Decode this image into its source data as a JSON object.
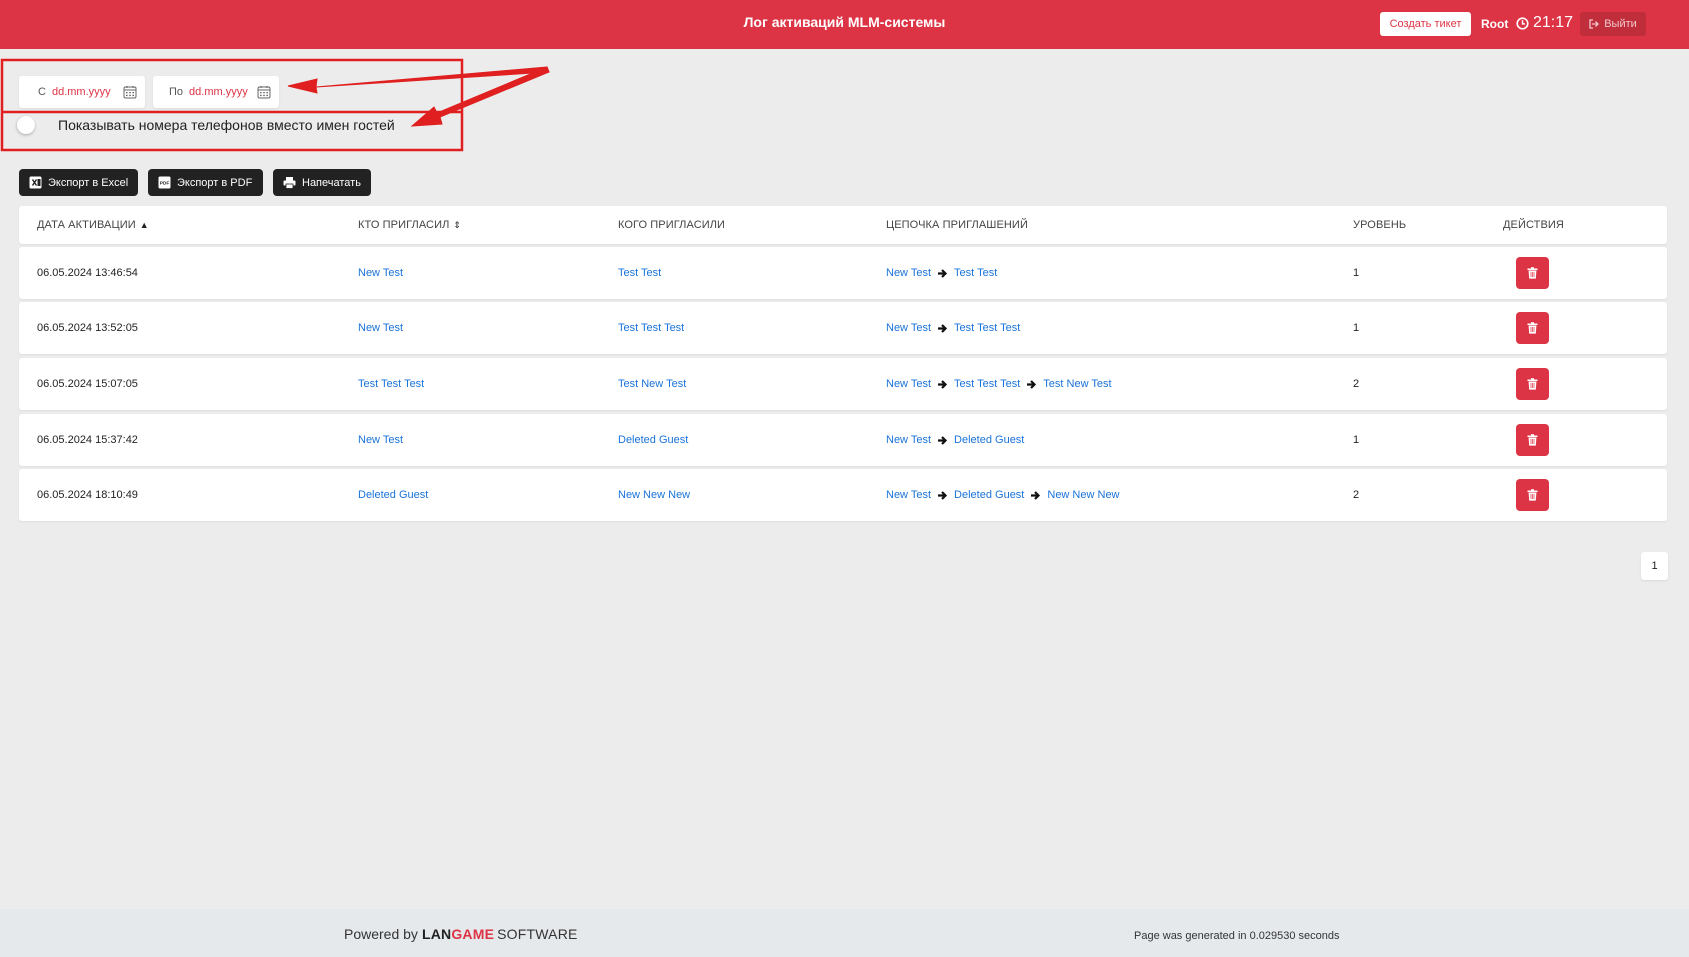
{
  "header": {
    "title": "Лог активаций MLM-системы",
    "create_ticket": "Создать тикет",
    "user": "Root",
    "time": "21:17",
    "logout": "Выйти",
    "brand_color": "#dd3445"
  },
  "filters": {
    "from_prefix": "С",
    "from_placeholder": "dd.mm.yyyy",
    "to_prefix": "По",
    "to_placeholder": "dd.mm.yyyy",
    "show_phones_label": "Показывать номера телефонов вместо имен гостей",
    "show_phones_checked": false
  },
  "export": {
    "excel": "Экспорт в Excel",
    "pdf": "Экспорт в PDF",
    "print": "Напечатать"
  },
  "table": {
    "columns": [
      "ДАТА АКТИВАЦИИ",
      "КТО ПРИГЛАСИЛ",
      "КОГО ПРИГЛАСИЛИ",
      "ЦЕПОЧКА ПРИГЛАШЕНИЙ",
      "УРОВЕНЬ",
      "ДЕЙСТВИЯ"
    ],
    "rows": [
      {
        "date": "06.05.2024 13:46:54",
        "inviter": "New Test",
        "invitee": "Test Test",
        "chain": [
          "New Test",
          "Test Test"
        ],
        "level": "1"
      },
      {
        "date": "06.05.2024 13:52:05",
        "inviter": "New Test",
        "invitee": "Test Test Test",
        "chain": [
          "New Test",
          "Test Test Test"
        ],
        "level": "1"
      },
      {
        "date": "06.05.2024 15:07:05",
        "inviter": "Test Test Test",
        "invitee": "Test New Test",
        "chain": [
          "New Test",
          "Test Test Test",
          "Test New Test"
        ],
        "level": "2"
      },
      {
        "date": "06.05.2024 15:37:42",
        "inviter": "New Test",
        "invitee": "Deleted Guest",
        "chain": [
          "New Test",
          "Deleted Guest"
        ],
        "level": "1"
      },
      {
        "date": "06.05.2024 18:10:49",
        "inviter": "Deleted Guest",
        "invitee": "New New New",
        "chain": [
          "New Test",
          "Deleted Guest",
          "New New New"
        ],
        "level": "2"
      }
    ]
  },
  "pagination": {
    "current": "1"
  },
  "footer": {
    "powered_by": "Powered by",
    "brand_part1": "LAN",
    "brand_part2": "GAME",
    "brand_part3": "SOFTWARE",
    "generated": "Page was generated in 0.029530 seconds"
  }
}
